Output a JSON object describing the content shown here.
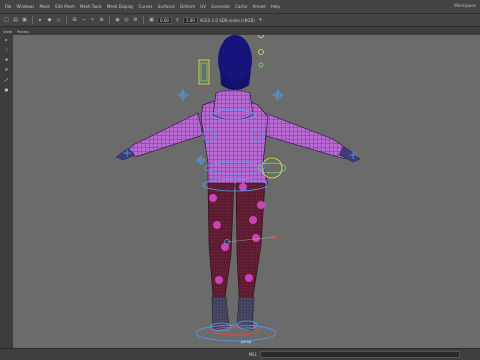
{
  "menubar": {
    "items": [
      "File",
      "Windows",
      "Mesh",
      "Edit Mesh",
      "Mesh Tools",
      "Mesh Display",
      "Curves",
      "Surfaces",
      "Deform",
      "UV",
      "Generate",
      "Cache",
      "Arnold",
      "Help"
    ],
    "workspace_label": "Workspace"
  },
  "statusline": {
    "field_value": "0.00",
    "field_value2": "1.00",
    "colorspace": "ACES 1.0 SDR-video (sRGB)"
  },
  "panel_menu": {
    "items": [
      "View",
      "Panels"
    ]
  },
  "toolbox": {
    "tools": [
      "▸",
      "◌",
      "✙",
      "⟳",
      "⤢",
      "▣"
    ]
  },
  "viewport": {
    "camera_label": "persp",
    "background_color": "#6b6b6b",
    "grid_color": "#5a5a5a",
    "mesh_color": "#b66ad2",
    "wire_color": "#3b1d52",
    "pants_color": "#5a1a2e",
    "hair_color": "#14147a",
    "spot_color": "#e24bd0",
    "control_blue": "#4aa3ff",
    "control_yellow": "#e8e84a",
    "control_green": "#73e05c",
    "control_red": "#ff4040"
  },
  "command_line": {
    "language": "MEL"
  }
}
